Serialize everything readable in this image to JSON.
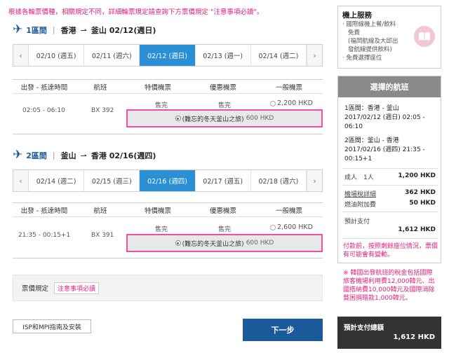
{
  "notice": "根據各輪票價種，相關規定不同，詳細輪票規定請查詢下方票價規定 \"注意事項必讀\"。",
  "segments": [
    {
      "label": "1區間",
      "from": "香港",
      "to": "釜山",
      "date": "02/12(週日)",
      "dates": [
        "02/10 (週五)",
        "02/11 (週六)",
        "02/12 (週日)",
        "02/13 (週一)",
        "02/14 (週二)"
      ],
      "active_index": 2,
      "time": "02:05 - 06:10",
      "flight": "BX 392",
      "special": "售完",
      "discount": "售完",
      "normal_price": "2,200",
      "promo_name": "(難忘的冬天釜山之旅)",
      "promo_price": "600 HKD"
    },
    {
      "label": "2區間",
      "from": "釜山",
      "to": "香港",
      "date": "02/16(週四)",
      "dates": [
        "02/14 (週二)",
        "02/15 (週三)",
        "02/16 (週四)",
        "02/17 (週五)",
        "02/18 (週六)"
      ],
      "active_index": 2,
      "time": "21:35 - 00:15+1",
      "flight": "BX 391",
      "special": "售完",
      "discount": "售完",
      "normal_price": "2,600",
      "promo_name": "(難忘的冬天釜山之旅)",
      "promo_price": "600 HKD"
    }
  ],
  "table_headers": [
    "出發 - 抵達時間",
    "航班",
    "特價機票",
    "優惠機票",
    "一般機票"
  ],
  "currency": "HKD",
  "rules": {
    "label": "票價規定",
    "link": "注意事項必讀"
  },
  "buttons": {
    "isp": "ISP和MPI指南及安裝",
    "next": "下一步"
  },
  "service": {
    "title": "機上服務",
    "items": [
      "· 國際線機上餐/飲料",
      "  免費",
      "  (福岡航線及大邱出",
      "  發航線提供飲料)",
      "· 免費選擇座位"
    ]
  },
  "summary": {
    "title": "選擇的航班",
    "seg1": [
      "1區間：香港 - 釜山",
      "2017/02/12 (週日) 02:05 -",
      "06:10"
    ],
    "seg2": [
      "2區間：釜山 - 香港",
      "2017/02/16 (週四) 21:35 -",
      "00:15+1"
    ],
    "adult_label": "成人　1人",
    "adult_value": "1,200 HKD",
    "tax_label": "機場稅詳細",
    "tax_value": "362 HKD",
    "fuel_label": "燃油附加費",
    "fuel_value": "50 HKD",
    "est_label": "預計支付",
    "est_value": "1,612 HKD",
    "warn1": "付款前，按照剩餘座位情況，票價有可能會有變動。",
    "warn2": "※ 韓國出發航班的稅金包括國際旅客機場利用費12,000韓元、出國搭納費10,000韓元及國際消除貧困捐贈款1,000韓元。"
  },
  "total": {
    "label": "預計支付總額",
    "value": "1,612 HKD"
  }
}
